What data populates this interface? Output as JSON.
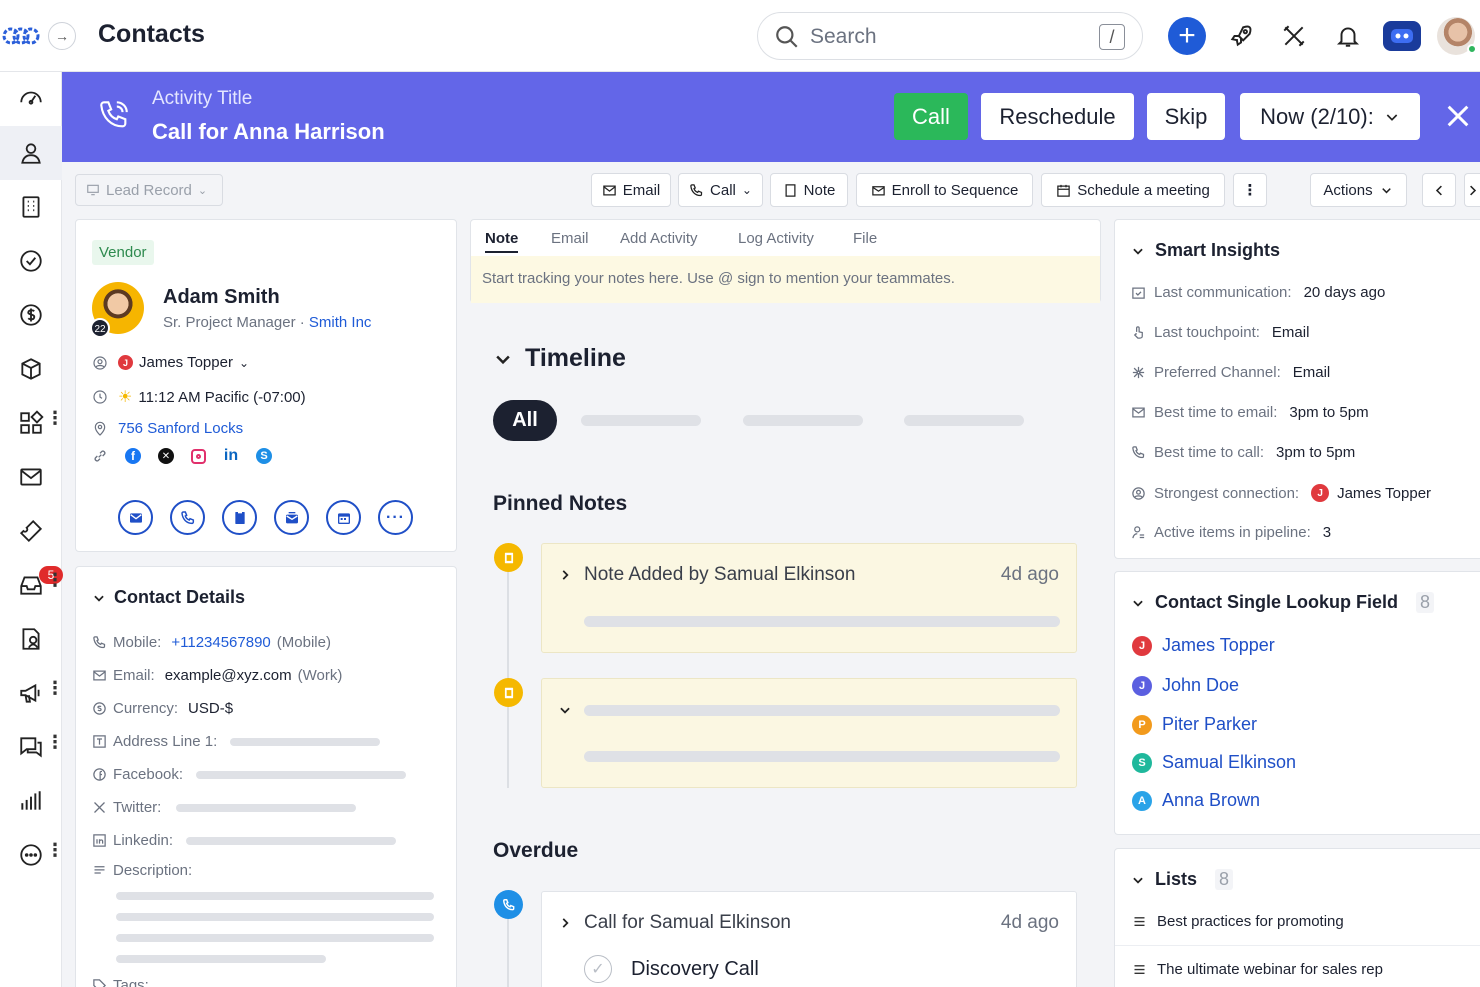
{
  "topbar": {
    "title": "Contacts",
    "search_placeholder": "Search",
    "search_shortcut": "/"
  },
  "banner": {
    "subtitle": "Activity Title",
    "title": "Call for Anna Harrison",
    "call": "Call",
    "reschedule": "Reschedule",
    "skip": "Skip",
    "now": "Now (2/10):"
  },
  "toolbar": {
    "lead_record": "Lead Record",
    "email": "Email",
    "call": "Call",
    "note": "Note",
    "enroll": "Enroll to Sequence",
    "schedule": "Schedule a meeting",
    "actions": "Actions"
  },
  "sidebar": {
    "inbox_badge": "5"
  },
  "profile": {
    "tag": "Vendor",
    "avatar_badge": "22",
    "name": "Adam Smith",
    "role": "Sr. Project Manager",
    "separator": "·",
    "company": "Smith Inc",
    "owner_initial": "J",
    "owner": "James Topper",
    "time": "11:12 AM Pacific (-07:00)",
    "address": "756 Sanford Locks"
  },
  "contact_details": {
    "title": "Contact Details",
    "mobile_label": "Mobile:",
    "mobile": "+11234567890",
    "mobile_type": "(Mobile)",
    "email_label": "Email:",
    "email": "example@xyz.com",
    "email_type": "(Work)",
    "currency_label": "Currency:",
    "currency": "USD-$",
    "address_label": "Address Line 1:",
    "facebook_label": "Facebook:",
    "twitter_label": "Twitter:",
    "linkedin_label": "Linkedin:",
    "description_label": "Description:",
    "tags_label": "Tags:"
  },
  "tabs": {
    "items": [
      "Note",
      "Email",
      "Add Activity",
      "Log Activity",
      "File"
    ],
    "note_placeholder": "Start tracking your notes here. Use @ sign to mention your teammates."
  },
  "timeline": {
    "title": "Timeline",
    "filter_all": "All",
    "pinned_title": "Pinned Notes",
    "pinned_note_title": "Note Added by Samual Elkinson",
    "pinned_note_age": "4d ago",
    "overdue_title": "Overdue",
    "overdue_title_item": "Call for Samual Elkinson",
    "overdue_age": "4d ago",
    "overdue_sub": "Discovery Call"
  },
  "insights": {
    "title": "Smart Insights",
    "rows": [
      {
        "label": "Last communication:",
        "value": "20 days ago"
      },
      {
        "label": "Last touchpoint:",
        "value": "Email"
      },
      {
        "label": "Preferred Channel:",
        "value": "Email"
      },
      {
        "label": "Best time to email:",
        "value": "3pm to 5pm"
      },
      {
        "label": "Best time to call:",
        "value": "3pm to 5pm"
      },
      {
        "label": "Strongest connection:",
        "value": "James Topper"
      },
      {
        "label": "Active items in pipeline:",
        "value": "3"
      }
    ],
    "connection_initial": "J"
  },
  "lookup": {
    "title": "Contact Single Lookup Field",
    "count": "8",
    "items": [
      {
        "initial": "J",
        "name": "James Topper",
        "color": "#e0393e"
      },
      {
        "initial": "J",
        "name": "John Doe",
        "color": "#5b5fe0"
      },
      {
        "initial": "P",
        "name": "Piter Parker",
        "color": "#f29a1c"
      },
      {
        "initial": "S",
        "name": "Samual Elkinson",
        "color": "#1fb89c"
      },
      {
        "initial": "A",
        "name": "Anna Brown",
        "color": "#2aa3e8"
      }
    ]
  },
  "lists": {
    "title": "Lists",
    "count": "8",
    "items": [
      "Best practices for promoting",
      "The ultimate webinar for sales rep"
    ]
  },
  "colors": {
    "banner": "#6366e8",
    "call_green": "#2bb85a",
    "link_blue": "#1f5bd7",
    "note_yellow": "#fbf7e2"
  }
}
